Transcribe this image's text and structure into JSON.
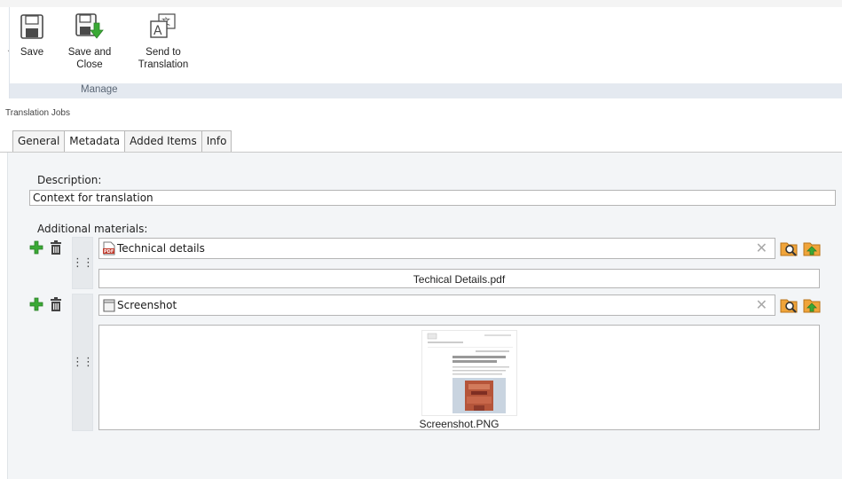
{
  "ribbon": {
    "buttons": [
      {
        "label_line1": "Save",
        "label_line2": "",
        "icon": "save-icon"
      },
      {
        "label_line1": "Save and",
        "label_line2": "Close",
        "icon": "save-and-close-icon"
      },
      {
        "label_line1": "Send to",
        "label_line2": "Translation",
        "icon": "send-to-translation-icon"
      }
    ],
    "group_label": "Manage"
  },
  "breadcrumb": "Translation Jobs",
  "tabs": [
    {
      "label": "General"
    },
    {
      "label": "Metadata",
      "active": true
    },
    {
      "label": "Added Items"
    },
    {
      "label": "Info"
    }
  ],
  "form": {
    "description_label": "Description:",
    "description_value": "Context for translation",
    "materials_label": "Additional materials:",
    "materials": [
      {
        "title": "Technical details",
        "file": "Techical Details.pdf",
        "icon": "pdf-icon"
      },
      {
        "title": "Screenshot",
        "file": "Screenshot.PNG",
        "icon": "image-file-icon"
      }
    ]
  },
  "colors": {
    "accent_green": "#3aa935",
    "ribbon_group_bg": "#e4e9f0",
    "panel_bg": "#f3f5f7",
    "folder_orange": "#f0a43a"
  }
}
